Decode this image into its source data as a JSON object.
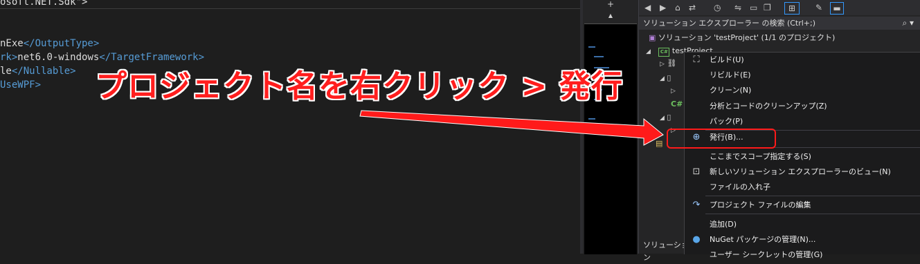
{
  "editor": {
    "top_line": "osoft.NET.Sdk\">",
    "lines": [
      {
        "a": "nExe",
        "b": "</OutputType>"
      },
      {
        "pre": "rk>",
        "a": "net6.0-windows",
        "b": "</TargetFramework>"
      },
      {
        "pre": "le",
        "b": "</Nullable>"
      },
      {
        "b": "UseWPF>"
      }
    ]
  },
  "annotation": "プロジェクト名を右クリック > 発行",
  "minimap": {
    "plus": "+",
    "up": "▲"
  },
  "solution_explorer": {
    "search_label": "ソリューション エクスプローラー の検索 (Ctrl+;)",
    "search_icon": "search-icon",
    "solution_row": "ソリューション 'testProject' (1/1 のプロジェクト)",
    "project_row": "testProject",
    "project_badge": "C#",
    "bottom_tab": "ソリューション"
  },
  "context_menu": {
    "items": [
      {
        "label": "ビルド(U)",
        "icon": "build-icon"
      },
      {
        "label": "リビルド(E)"
      },
      {
        "label": "クリーン(N)"
      },
      {
        "label": "分析とコードのクリーンアップ(Z)"
      },
      {
        "label": "パック(P)"
      },
      {
        "label": "発行(B)...",
        "icon": "globe-icon"
      },
      {
        "label": "ここまでスコープ指定する(S)"
      },
      {
        "label": "新しいソリューション エクスプローラーのビュー(N)",
        "icon": "new-view-icon"
      },
      {
        "label": "ファイルの入れ子"
      },
      {
        "label": "プロジェクト ファイルの編集",
        "icon": "refresh-icon"
      },
      {
        "label": "追加(D)"
      },
      {
        "label": "NuGet パッケージの管理(N)...",
        "icon": "nuget-icon"
      },
      {
        "label": "ユーザー シークレットの管理(G)"
      }
    ]
  },
  "colors": {
    "annotation": "#ff1e1e",
    "highlight": "#ff1a1a",
    "tag": "#569cd6"
  }
}
